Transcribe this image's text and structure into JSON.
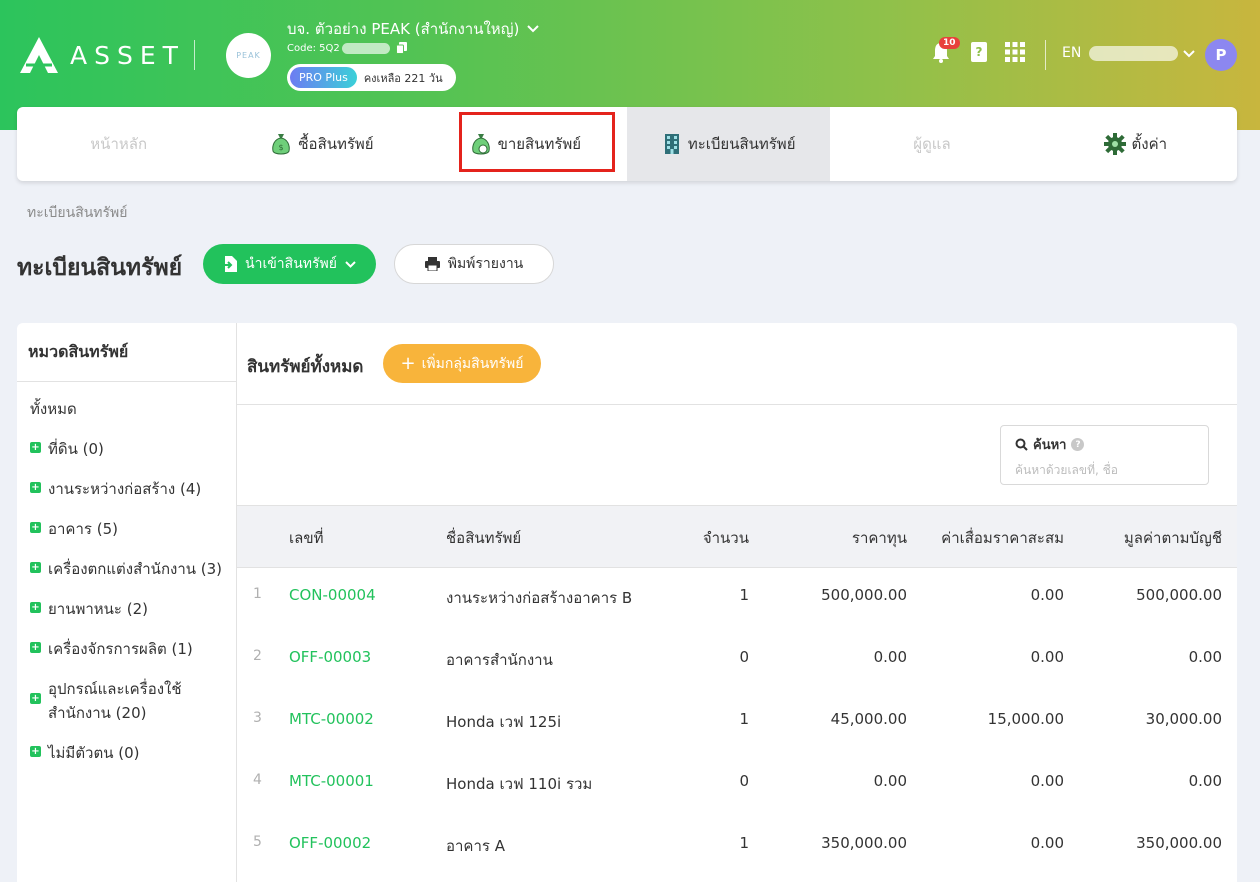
{
  "header": {
    "brand": "ASSET",
    "partner_logo": "PEAK",
    "company_name": "บจ. ตัวอย่าง PEAK (สำนักงานใหญ่)",
    "code_label": "Code: 5Q2",
    "plan": "PRO Plus",
    "days_left": "คงเหลือ 221 วัน",
    "notification_count": "10",
    "language": "EN",
    "avatar_initial": "P",
    "icons": {
      "notification": "bell-icon",
      "manual": "book-icon",
      "apps": "grid-icon",
      "copy": "copy-icon"
    }
  },
  "nav": {
    "tabs": [
      {
        "label": "หน้าหลัก",
        "icon": null,
        "state": "disabled"
      },
      {
        "label": "ซื้อสินทรัพย์",
        "icon": "money-bag-icon",
        "state": "normal"
      },
      {
        "label": "ขายสินทรัพย์",
        "icon": "money-bag-icon",
        "state": "highlighted"
      },
      {
        "label": "ทะเบียนสินทรัพย์",
        "icon": "building-icon",
        "state": "active"
      },
      {
        "label": "ผู้ดูแล",
        "icon": null,
        "state": "disabled"
      },
      {
        "label": "ตั้งค่า",
        "icon": "gear-icon",
        "state": "normal"
      }
    ]
  },
  "breadcrumb": "ทะเบียนสินทรัพย์",
  "page_title": "ทะเบียนสินทรัพย์",
  "actions": {
    "import_label": "นำเข้าสินทรัพย์",
    "print_label": "พิมพ์รายงาน"
  },
  "sidebar": {
    "title": "หมวดสินทรัพย์",
    "all_label": "ทั้งหมด",
    "categories": [
      {
        "label": "ที่ดิน (0)"
      },
      {
        "label": "งานระหว่างก่อสร้าง (4)"
      },
      {
        "label": "อาคาร (5)"
      },
      {
        "label": "เครื่องตกแต่งสำนักงาน (3)"
      },
      {
        "label": "ยานพาหนะ (2)"
      },
      {
        "label": "เครื่องจักรการผลิต (1)"
      },
      {
        "label": "อุปกรณ์และเครื่องใช้",
        "label2": "สำนักงาน (20)"
      },
      {
        "label": "ไม่มีตัวตน (0)"
      }
    ]
  },
  "main": {
    "title": "สินทรัพย์ทั้งหมด",
    "add_group_label": "เพิ่มกลุ่มสินทรัพย์",
    "search": {
      "label": "ค้นหา",
      "placeholder": "ค้นหาด้วยเลขที่, ชื่อ"
    },
    "table": {
      "headers": [
        "เลขที่",
        "ชื่อสินทรัพย์",
        "จำนวน",
        "ราคาทุน",
        "ค่าเสื่อมราคาสะสม",
        "มูลค่าตามบัญชี"
      ],
      "rows": [
        {
          "no": "1",
          "code": "CON-00004",
          "name": "งานระหว่างก่อสร้างอาคาร B",
          "qty": "1",
          "cost": "500,000.00",
          "dep": "0.00",
          "book": "500,000.00"
        },
        {
          "no": "2",
          "code": "OFF-00003",
          "name": "อาคารสำนักงาน",
          "qty": "0",
          "cost": "0.00",
          "dep": "0.00",
          "book": "0.00"
        },
        {
          "no": "3",
          "code": "MTC-00002",
          "name": "Honda เวฟ 125i",
          "qty": "1",
          "cost": "45,000.00",
          "dep": "15,000.00",
          "book": "30,000.00"
        },
        {
          "no": "4",
          "code": "MTC-00001",
          "name": "Honda เวฟ 110i รวม",
          "qty": "0",
          "cost": "0.00",
          "dep": "0.00",
          "book": "0.00"
        },
        {
          "no": "5",
          "code": "OFF-00002",
          "name": "อาคาร A",
          "qty": "1",
          "cost": "350,000.00",
          "dep": "0.00",
          "book": "350,000.00"
        }
      ]
    }
  }
}
